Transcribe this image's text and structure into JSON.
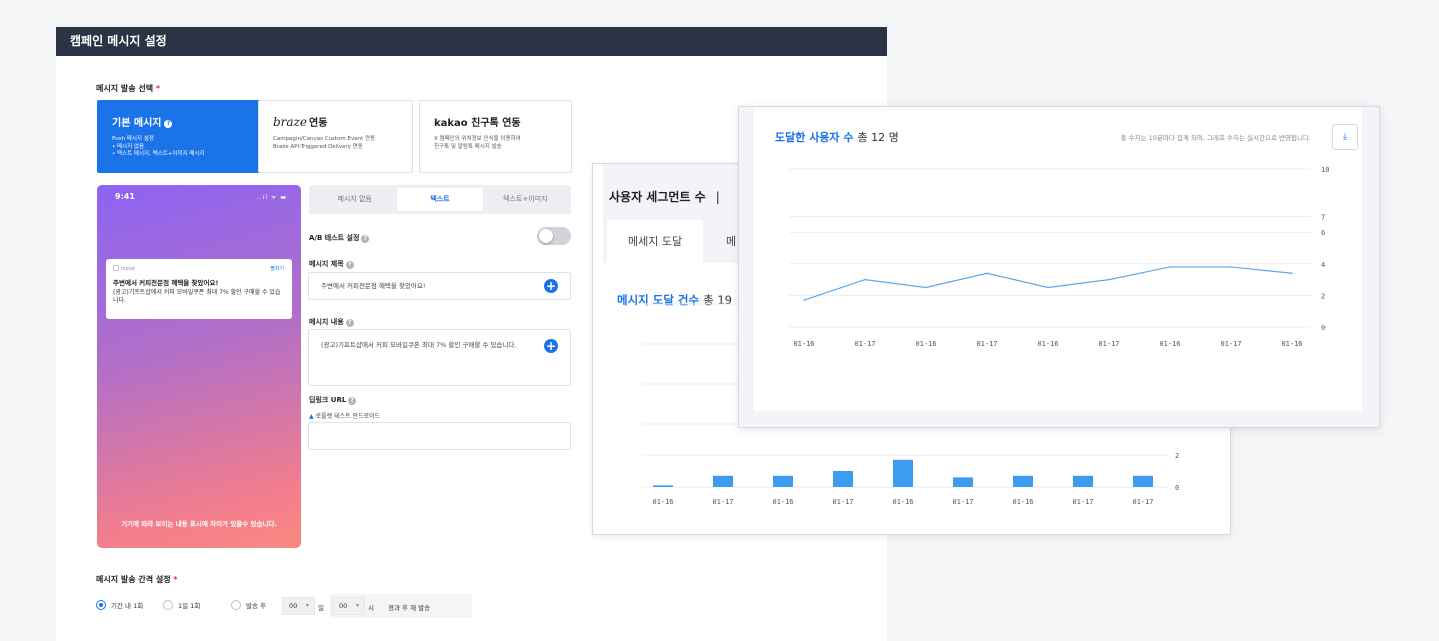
{
  "main": {
    "header_title": "캠페인 메시지 설정",
    "send_select_label": "메시지 발송 선택",
    "required_mark": "*",
    "cards": [
      {
        "title": "기본 메시지",
        "desc": "Push 메시지 설정\n • 메시지 없음\n • 텍스트 메시지, 텍스트+이미지 메시지"
      },
      {
        "title_logo": "braze",
        "title": "연동",
        "desc": "Campagin/Canvas Custom Event 연동\nBraze API-Triggered Delivery 연동"
      },
      {
        "title": "kakao 친구톡 연동",
        "desc": "X 캠페인의 위치정보 인식을 이용하여\n친구톡 및 알림톡 메시지 발송"
      }
    ],
    "phone": {
      "time": "9:41",
      "status": "..ıl ᯤ ▬",
      "app_name": "loplat",
      "expand": "펼치기",
      "notif_title": "주변에서 커피전문점 혜택을 찾았어요!",
      "notif_body": "(광고)기프트샵에서 커피 모바일쿠폰 최대 7% 할인 구매할 수 있습니다.",
      "footer": "기기에 따라 보이는 내용 표시에 차이가 있을수 있습니다."
    },
    "type_tabs": [
      "메시지 없음",
      "텍스트",
      "텍스트+이미지"
    ],
    "active_type_tab": 1,
    "ab_test_label": "A/B 테스트 설정",
    "ab_test_on": false,
    "title_label": "메시지 제목",
    "title_value": "주변에서 커피전문점 혜택을 찾았어요!",
    "content_label": "메시지 내용",
    "content_value": "(광고)기프트샵에서 커피 모바일쿠폰 최대 7% 할인 구매할 수 있습니다.",
    "deeplink_label": "딥링크 URL",
    "deeplink_platform": "로플랫 테스트 안드로이드",
    "interval_label": "메시지 발송 간격 설정",
    "interval_options": [
      "기간 내 1회",
      "1일 1회",
      "발송 후"
    ],
    "interval_selected": 0,
    "day_value": "00",
    "day_unit": "일",
    "hour_value": "00",
    "hour_unit": "시",
    "interval_suffix": "경과 후 재 발송"
  },
  "segment": {
    "title": "사용자 세그먼트 수",
    "separator": "|",
    "tabs": [
      "메세지 도달",
      "메"
    ],
    "reach_label": "메시지 도달 건수",
    "reach_total": "총 19"
  },
  "users": {
    "title": "도달한 사용자 수",
    "total": "총 12 명",
    "note": "총 수치는 10분마다 집계 되며, 그래프 수치는 실시간으로 반영됩니다.",
    "download_icon": "download-icon"
  },
  "chart_data": [
    {
      "type": "line",
      "title": "도달한 사용자 수",
      "categories": [
        "01-16",
        "01-17",
        "01-16",
        "01-17",
        "01-16",
        "01-17",
        "01-16",
        "01-17",
        "01-16"
      ],
      "values": [
        1.7,
        3.0,
        2.5,
        3.4,
        2.5,
        3.0,
        3.8,
        3.8,
        3.4
      ],
      "ylim": [
        0,
        10
      ],
      "yticks": [
        0,
        2,
        4,
        6,
        7,
        10
      ],
      "color": "#5aa9f0"
    },
    {
      "type": "bar",
      "title": "메시지 도달 건수",
      "categories": [
        "01-16",
        "01-17",
        "01-16",
        "01-17",
        "01-16",
        "01-17",
        "01-16",
        "01-17",
        "01-17"
      ],
      "values": [
        0.1,
        0.7,
        0.7,
        1.0,
        1.7,
        0.6,
        0.7,
        0.7,
        0.7
      ],
      "ylim": [
        0,
        2
      ],
      "yticks": [
        0,
        2
      ],
      "color": "#3d9bf0"
    }
  ]
}
